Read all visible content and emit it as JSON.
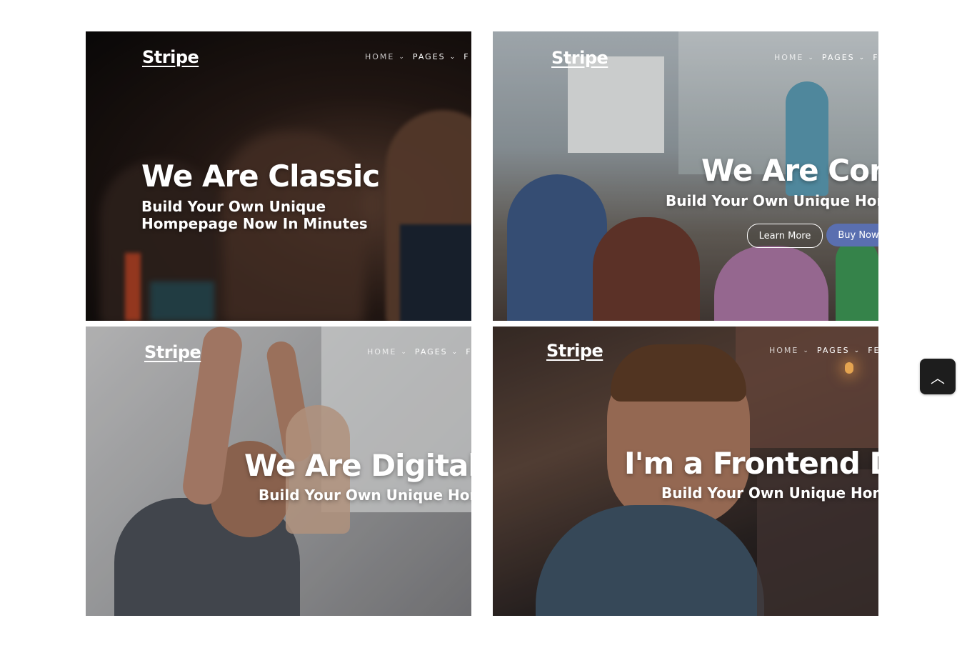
{
  "cards": [
    {
      "logo": "Stripe",
      "nav": [
        "HOME",
        "PAGES",
        "F"
      ],
      "headline": "We Are Classic",
      "subtitle_line1": "Build Your Own Unique",
      "subtitle_line2": "Hompepage Now In Minutes"
    },
    {
      "logo": "Stripe",
      "nav": [
        "HOME",
        "PAGES",
        "F"
      ],
      "headline": "We Are Con",
      "subtitle_line1": "Build Your Own Unique Homp",
      "buttons": {
        "learn_more": "Learn More",
        "buy_now": "Buy Now"
      }
    },
    {
      "logo": "Stripe",
      "nav": [
        "HOME",
        "PAGES",
        "F"
      ],
      "headline": "We Are Digital A",
      "subtitle_line1": "Build Your Own Unique Homp"
    },
    {
      "logo": "Stripe",
      "nav": [
        "HOME",
        "PAGES",
        "FE"
      ],
      "headline": "I'm a Frontend De",
      "subtitle_line1": "Build Your Own Unique Homp"
    }
  ],
  "scroll_top": {
    "icon": "chevron-up-icon",
    "glyph": "︿"
  },
  "icons": {
    "chevron": "chevron-down-icon"
  }
}
